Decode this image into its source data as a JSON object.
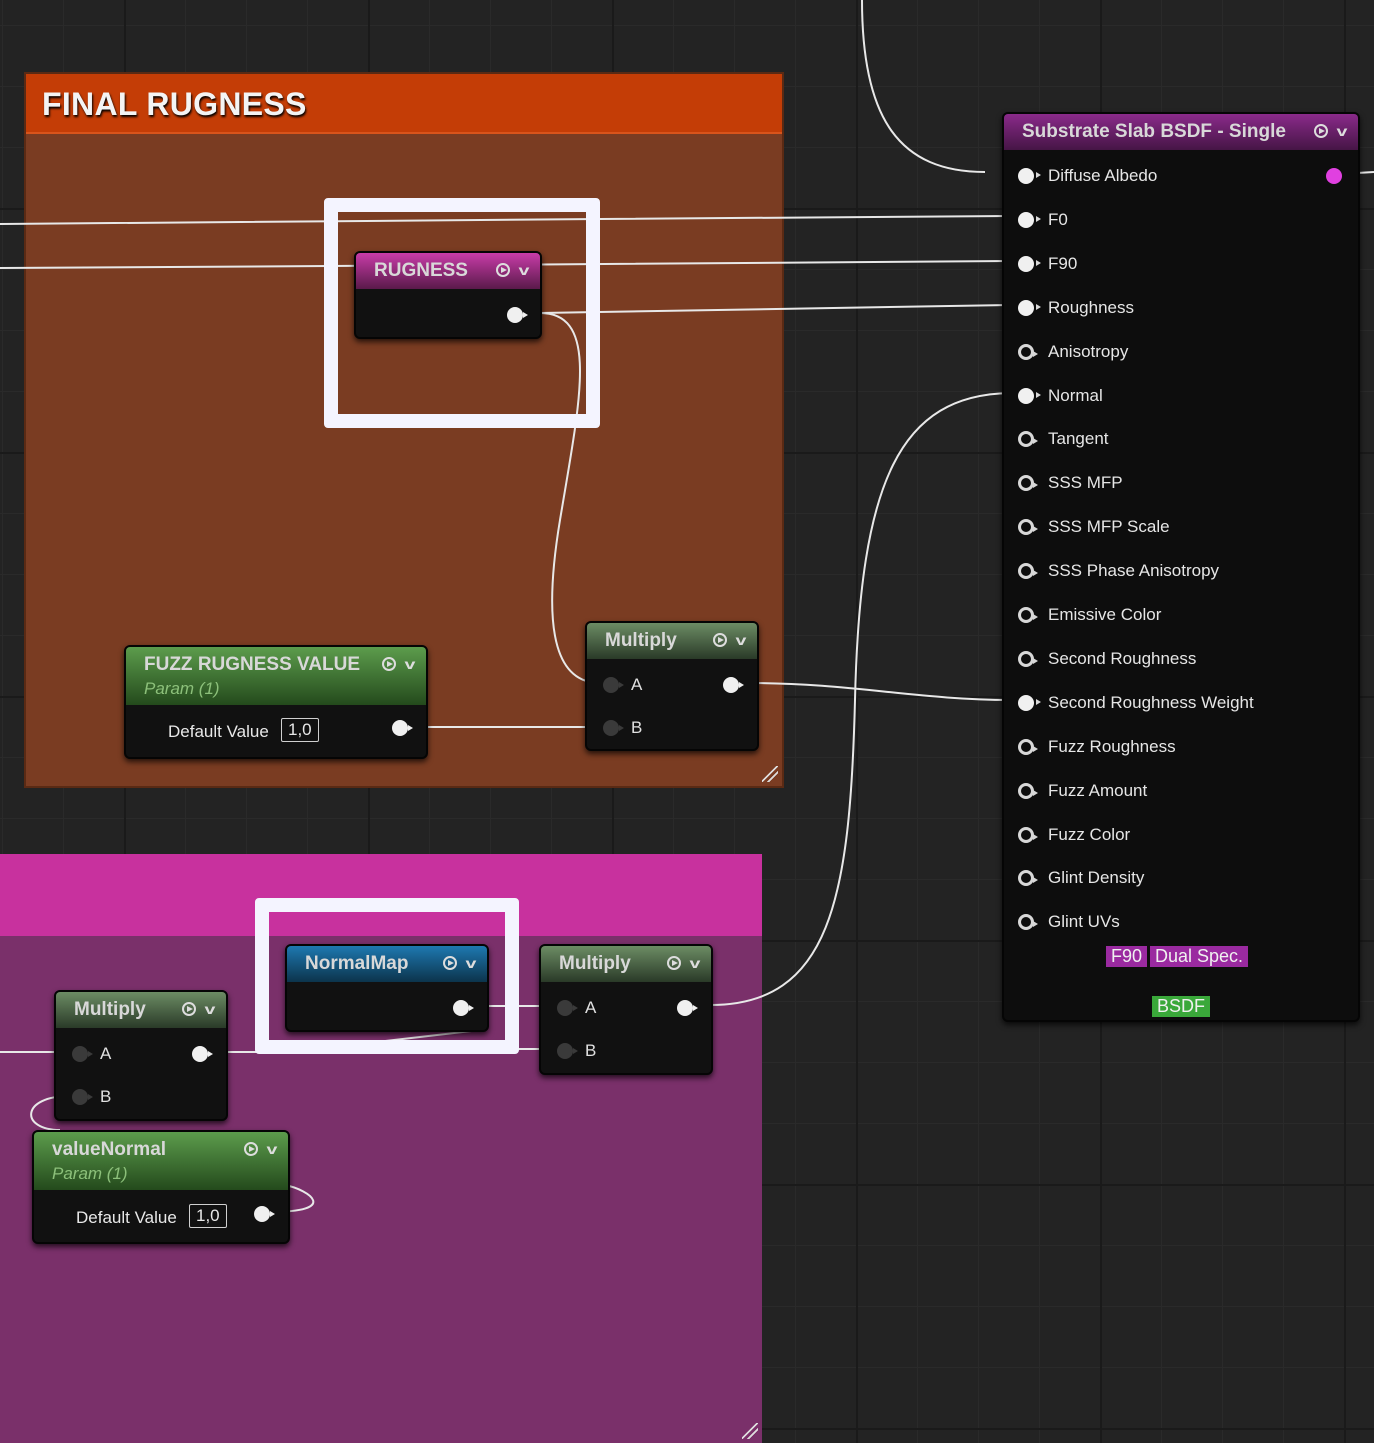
{
  "colors": {
    "comment_orange_header": "#c43d06",
    "comment_orange_body": "#7a3c22",
    "comment_pink_header": "#c8319e",
    "comment_pink_body": "#7a306a",
    "wire": "#e8e8e8",
    "bsdf_out_pin": "#e040e0",
    "tag_purple": "#9a2aa0",
    "tag_green": "#3aa83a"
  },
  "comment_final_rugness": {
    "title": "FINAL RUGNESS"
  },
  "nodes": {
    "rugness": {
      "title": "RUGNESS"
    },
    "fuzz_rugness_value": {
      "title": "FUZZ RUGNESS VALUE",
      "subtitle": "Param (1)",
      "default_label": "Default Value",
      "default_value": "1,0"
    },
    "multiply_top": {
      "title": "Multiply",
      "pin_a": "A",
      "pin_b": "B"
    },
    "normal_map": {
      "title": "NormalMap"
    },
    "multiply_mid": {
      "title": "Multiply",
      "pin_a": "A",
      "pin_b": "B"
    },
    "multiply_left": {
      "title": "Multiply",
      "pin_a": "A",
      "pin_b": "B"
    },
    "value_normal": {
      "title": "valueNormal",
      "subtitle": "Param (1)",
      "default_label": "Default Value",
      "default_value": "1,0"
    }
  },
  "bsdf": {
    "title": "Substrate Slab BSDF - Single",
    "inputs": [
      {
        "label": "Diffuse Albedo",
        "connected": true
      },
      {
        "label": "F0",
        "connected": true
      },
      {
        "label": "F90",
        "connected": true
      },
      {
        "label": "Roughness",
        "connected": true
      },
      {
        "label": "Anisotropy",
        "connected": false
      },
      {
        "label": "Normal",
        "connected": true
      },
      {
        "label": "Tangent",
        "connected": false
      },
      {
        "label": "SSS MFP",
        "connected": false
      },
      {
        "label": "SSS MFP Scale",
        "connected": false
      },
      {
        "label": "SSS Phase Anisotropy",
        "connected": false
      },
      {
        "label": "Emissive Color",
        "connected": false
      },
      {
        "label": "Second Roughness",
        "connected": false
      },
      {
        "label": "Second Roughness Weight",
        "connected": true
      },
      {
        "label": "Fuzz Roughness",
        "connected": false
      },
      {
        "label": "Fuzz Amount",
        "connected": false
      },
      {
        "label": "Fuzz Color",
        "connected": false
      },
      {
        "label": "Glint Density",
        "connected": false
      },
      {
        "label": "Glint UVs",
        "connected": false
      }
    ],
    "tag_f90": "F90",
    "tag_dual_spec": "Dual Spec.",
    "tag_bsdf": "BSDF"
  }
}
